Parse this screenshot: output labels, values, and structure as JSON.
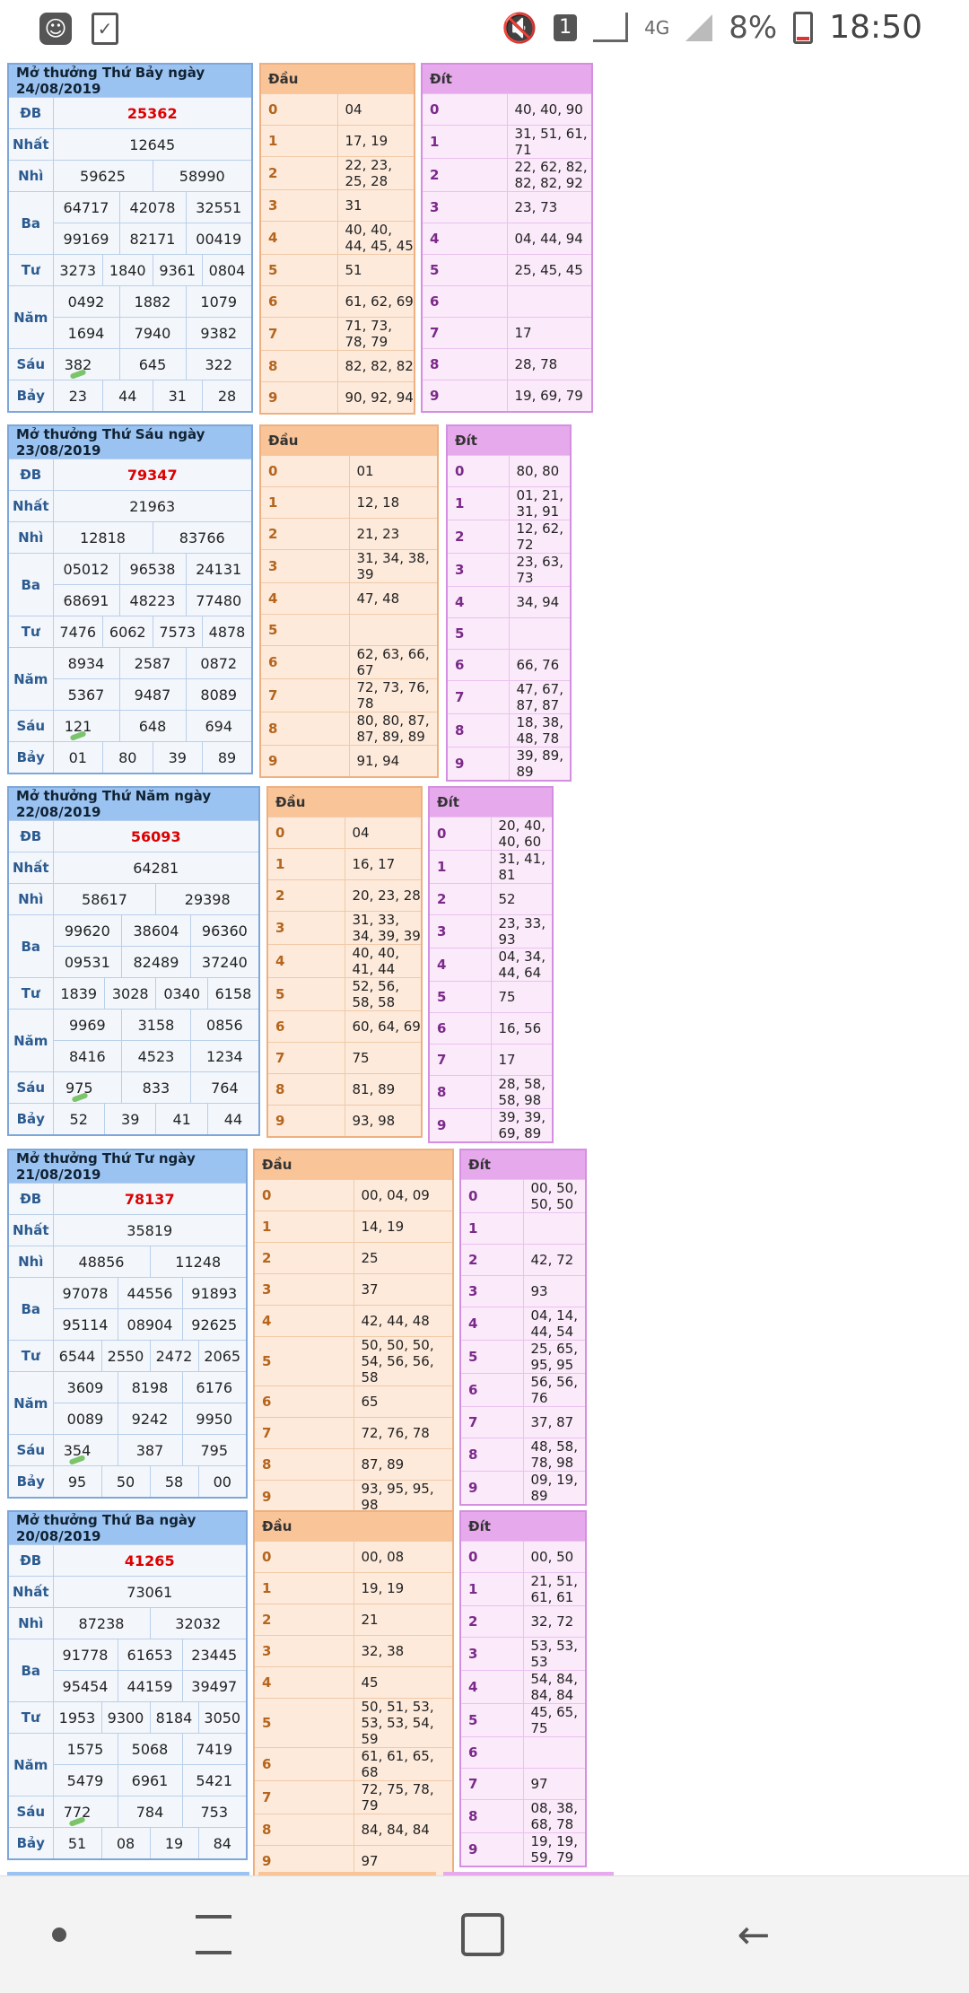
{
  "status": {
    "time": "18:50",
    "battery": "8%",
    "network": "4G",
    "sim": "1"
  },
  "labels": {
    "db": "ĐB",
    "nhat": "Nhất",
    "nhi": "Nhì",
    "ba": "Ba",
    "tu": "Tư",
    "nam": "Năm",
    "sau": "Sáu",
    "bay": "Bảy",
    "dau": "Đầu",
    "dit": "Đít"
  },
  "draws": [
    {
      "title": "Mở thưởng Thứ Bảy ngày 24/08/2019",
      "db": "25362",
      "nhat": "12645",
      "nhi": [
        "59625",
        "58990"
      ],
      "ba": [
        "64717",
        "42078",
        "32551",
        "99169",
        "82171",
        "00419"
      ],
      "tu": [
        "3273",
        "1840",
        "9361",
        "0804"
      ],
      "nam": [
        "0492",
        "1882",
        "1079",
        "1694",
        "7940",
        "9382"
      ],
      "sau": [
        "382",
        "645",
        "322"
      ],
      "bay": [
        "23",
        "44",
        "31",
        "28"
      ],
      "dau": [
        "04",
        "17, 19",
        "22, 23, 25, 28",
        "31",
        "40, 40, 44, 45, 45",
        "51",
        "61, 62, 69",
        "71, 73, 78, 79",
        "82, 82, 82",
        "90, 92, 94"
      ],
      "dit": [
        "40, 40, 90",
        "31, 51, 61, 71",
        "22, 62, 82, 82, 82, 92",
        "23, 73",
        "04, 44, 94",
        "25, 45, 45",
        "",
        "17",
        "28, 78",
        "19, 69, 79"
      ]
    },
    {
      "title": "Mở thưởng Thứ Sáu ngày 23/08/2019",
      "db": "79347",
      "nhat": "21963",
      "nhi": [
        "12818",
        "83766"
      ],
      "ba": [
        "05012",
        "96538",
        "24131",
        "68691",
        "48223",
        "77480"
      ],
      "tu": [
        "7476",
        "6062",
        "7573",
        "4878"
      ],
      "nam": [
        "8934",
        "2587",
        "0872",
        "5367",
        "9487",
        "8089"
      ],
      "sau": [
        "121",
        "648",
        "694"
      ],
      "bay": [
        "01",
        "80",
        "39",
        "89"
      ],
      "dau": [
        "01",
        "12, 18",
        "21, 23",
        "31, 34, 38, 39",
        "47, 48",
        "",
        "62, 63, 66, 67",
        "72, 73, 76, 78",
        "80, 80, 87, 87, 89, 89",
        "91, 94"
      ],
      "dit": [
        "80, 80",
        "01, 21, 31, 91",
        "12, 62, 72",
        "23, 63, 73",
        "34, 94",
        "",
        "66, 76",
        "47, 67, 87, 87",
        "18, 38, 48, 78",
        "39, 89, 89"
      ]
    },
    {
      "title": "Mở thưởng Thứ Năm ngày 22/08/2019",
      "db": "56093",
      "nhat": "64281",
      "nhi": [
        "58617",
        "29398"
      ],
      "ba": [
        "99620",
        "38604",
        "96360",
        "09531",
        "82489",
        "37240"
      ],
      "tu": [
        "1839",
        "3028",
        "0340",
        "6158"
      ],
      "nam": [
        "9969",
        "3158",
        "0856",
        "8416",
        "4523",
        "1234"
      ],
      "sau": [
        "975",
        "833",
        "764"
      ],
      "bay": [
        "52",
        "39",
        "41",
        "44"
      ],
      "dau": [
        "04",
        "16, 17",
        "20, 23, 28",
        "31, 33, 34, 39, 39",
        "40, 40, 41, 44",
        "52, 56, 58, 58",
        "60, 64, 69",
        "75",
        "81, 89",
        "93, 98"
      ],
      "dit": [
        "20, 40, 40, 60",
        "31, 41, 81",
        "52",
        "23, 33, 93",
        "04, 34, 44, 64",
        "75",
        "16, 56",
        "17",
        "28, 58, 58, 98",
        "39, 39, 69, 89"
      ]
    },
    {
      "title": "Mở thưởng Thứ Tư ngày 21/08/2019",
      "db": "78137",
      "nhat": "35819",
      "nhi": [
        "48856",
        "11248"
      ],
      "ba": [
        "97078",
        "44556",
        "91893",
        "95114",
        "08904",
        "92625"
      ],
      "tu": [
        "6544",
        "2550",
        "2472",
        "2065"
      ],
      "nam": [
        "3609",
        "8198",
        "6176",
        "0089",
        "9242",
        "9950"
      ],
      "sau": [
        "354",
        "387",
        "795"
      ],
      "bay": [
        "95",
        "50",
        "58",
        "00"
      ],
      "dau": [
        "00, 04, 09",
        "14, 19",
        "25",
        "37",
        "42, 44, 48",
        "50, 50, 50, 54, 56, 56, 58",
        "65",
        "72, 76, 78",
        "87, 89",
        "93, 95, 95, 98"
      ],
      "dit": [
        "00, 50, 50, 50",
        "",
        "42, 72",
        "93",
        "04, 14, 44, 54",
        "25, 65, 95, 95",
        "56, 56, 76",
        "37, 87",
        "48, 58, 78, 98",
        "09, 19, 89"
      ]
    },
    {
      "title": "Mở thưởng Thứ Ba ngày 20/08/2019",
      "db": "41265",
      "nhat": "73061",
      "nhi": [
        "87238",
        "32032"
      ],
      "ba": [
        "91778",
        "61653",
        "23445",
        "95454",
        "44159",
        "39497"
      ],
      "tu": [
        "1953",
        "9300",
        "8184",
        "3050"
      ],
      "nam": [
        "1575",
        "5068",
        "7419",
        "5479",
        "6961",
        "5421"
      ],
      "sau": [
        "772",
        "784",
        "753"
      ],
      "bay": [
        "51",
        "08",
        "19",
        "84"
      ],
      "dau": [
        "00, 08",
        "19, 19",
        "21",
        "32, 38",
        "45",
        "50, 51, 53, 53, 53, 54, 59",
        "61, 61, 65, 68",
        "72, 75, 78, 79",
        "84, 84, 84",
        "97"
      ],
      "dit": [
        "00, 50",
        "21, 51, 61, 61",
        "32, 72",
        "53, 53, 53",
        "54, 84, 84, 84",
        "45, 65, 75",
        "",
        "97",
        "08, 38, 68, 78",
        "19, 19, 59, 79"
      ]
    }
  ],
  "colors": {
    "result_header": "#9bc3f1",
    "dau_header": "#f9c498",
    "dit_header": "#e6a9ec",
    "db_red": "#dd0000"
  }
}
